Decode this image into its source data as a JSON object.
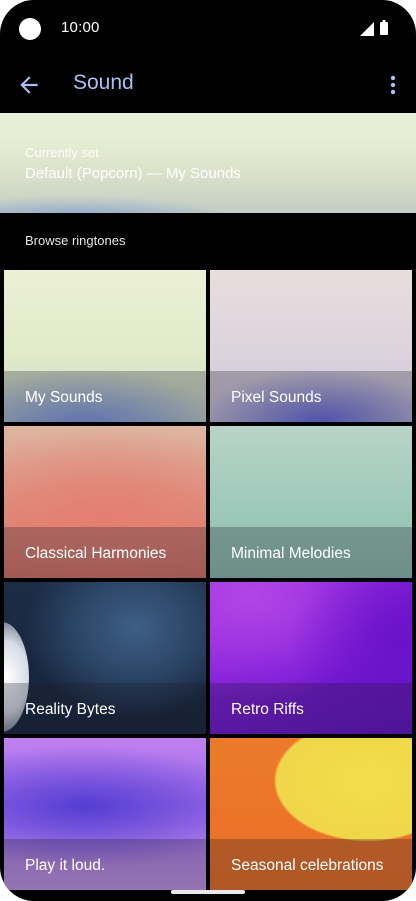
{
  "status_bar": {
    "time": "10:00"
  },
  "app_bar": {
    "title": "Sound"
  },
  "current": {
    "label": "Currently set",
    "value": "Default (Popcorn) — My Sounds"
  },
  "browse_heading": "Browse ringtones",
  "categories": [
    {
      "label": "My Sounds"
    },
    {
      "label": "Pixel Sounds"
    },
    {
      "label": "Classical Harmonies"
    },
    {
      "label": "Minimal Melodies"
    },
    {
      "label": "Reality Bytes"
    },
    {
      "label": "Retro Riffs"
    },
    {
      "label": "Play it loud."
    },
    {
      "label": "Seasonal celebrations"
    }
  ],
  "colors": {
    "title_accent": "#a8c0f5",
    "background": "#000000"
  }
}
